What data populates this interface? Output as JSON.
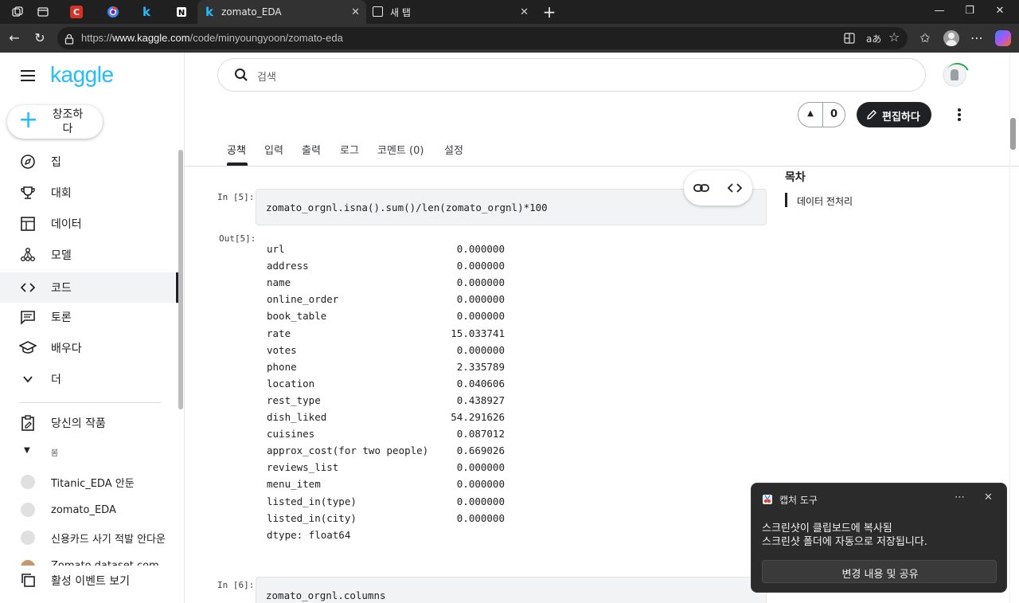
{
  "browser": {
    "tabs": [
      {
        "label": "zomato_EDA"
      },
      {
        "label": "새 탭"
      }
    ],
    "url_prefix": "https://",
    "url_host": "www.kaggle.com",
    "url_path": "/code/minyoungyoon/zomato-eda",
    "translate_label": "aあ"
  },
  "sidebar": {
    "logo": "kaggle",
    "create_label": "창조하다",
    "items": [
      {
        "label": "집"
      },
      {
        "label": "대회"
      },
      {
        "label": "데이터"
      },
      {
        "label": "모델"
      },
      {
        "label": "코드"
      },
      {
        "label": "토론"
      },
      {
        "label": "배우다"
      },
      {
        "label": "더"
      }
    ],
    "your_work": "당신의 작품",
    "section_label": "봄",
    "recent": [
      {
        "label": "Titanic_EDA 안둔"
      },
      {
        "label": "zomato_EDA"
      },
      {
        "label": "신용카드 사기 적발 안다운"
      },
      {
        "label": "Zomato dataset.com"
      }
    ],
    "activity": "활성 이벤트 보기"
  },
  "header": {
    "search_placeholder": "검색",
    "vote_count": "0",
    "edit_label": "편집하다",
    "tabs": [
      {
        "label": "공책"
      },
      {
        "label": "입력"
      },
      {
        "label": "출력"
      },
      {
        "label": "로그"
      },
      {
        "label": "코멘트 (0)"
      },
      {
        "label": "설정"
      }
    ]
  },
  "toc": {
    "title": "목차",
    "items": [
      {
        "label": "데이터 전처리"
      }
    ]
  },
  "notebook": {
    "cell5": {
      "in_label": "In [5]:",
      "code": "zomato_orgnl.isna().sum()/len(zomato_orgnl)*100",
      "out_label": "Out[5]:",
      "rows": [
        {
          "name": "url",
          "value": "0.000000"
        },
        {
          "name": "address",
          "value": "0.000000"
        },
        {
          "name": "name",
          "value": "0.000000"
        },
        {
          "name": "online_order",
          "value": "0.000000"
        },
        {
          "name": "book_table",
          "value": "0.000000"
        },
        {
          "name": "rate",
          "value": "15.033741"
        },
        {
          "name": "votes",
          "value": "0.000000"
        },
        {
          "name": "phone",
          "value": "2.335789"
        },
        {
          "name": "location",
          "value": "0.040606"
        },
        {
          "name": "rest_type",
          "value": "0.438927"
        },
        {
          "name": "dish_liked",
          "value": "54.291626"
        },
        {
          "name": "cuisines",
          "value": "0.087012"
        },
        {
          "name": "approx_cost(for two people)",
          "value": "0.669026"
        },
        {
          "name": "reviews_list",
          "value": "0.000000"
        },
        {
          "name": "menu_item",
          "value": "0.000000"
        },
        {
          "name": "listed_in(type)",
          "value": "0.000000"
        },
        {
          "name": "listed_in(city)",
          "value": "0.000000"
        }
      ],
      "dtype": "dtype: float64"
    },
    "cell6": {
      "in_label": "In [6]:",
      "code": "zomato_orgnl.columns"
    }
  },
  "toast": {
    "title": "캡처 도구",
    "line1": "스크린샷이 클립보드에 복사됨",
    "line2": "스크린샷 폴더에 자동으로 저장됩니다.",
    "button": "변경 내용 및 공유"
  },
  "colors": {
    "kaggle_blue": "#20beff",
    "chrome_dark": "#202020",
    "toolbar": "#323232"
  }
}
